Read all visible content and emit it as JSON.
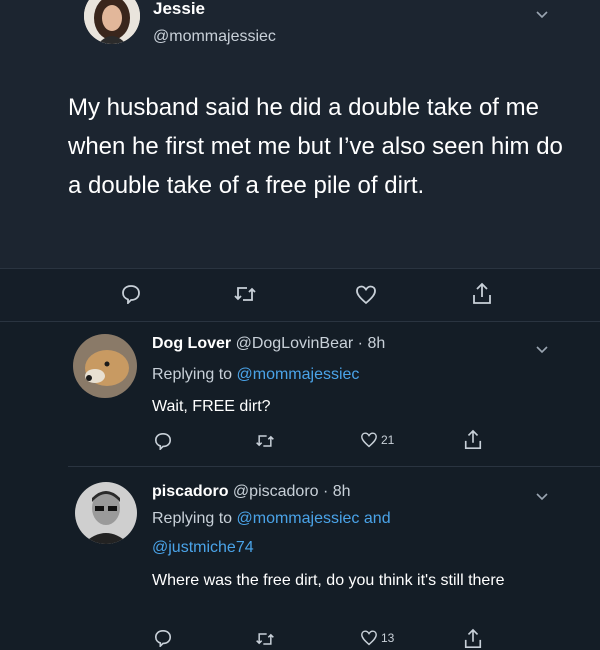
{
  "main_tweet": {
    "name": "Jessie",
    "handle": "@mommajessiec",
    "text": "My husband said he did a double take of me when he first met me but I’ve also seen him do a double take of a free pile of dirt."
  },
  "replies": [
    {
      "name": "Dog Lover",
      "handle": "@DogLovinBear",
      "time": "· 8h",
      "replying_prefix": "Replying to",
      "replying_to_1": "@mommajessiec",
      "text": "Wait, FREE dirt?",
      "likes": "21"
    },
    {
      "name": "piscadoro",
      "handle": "@piscadoro",
      "time": "· 8h",
      "replying_prefix": "Replying to",
      "replying_to_1": "@mommajessiec",
      "replying_and": "and",
      "replying_to_2": "@justmiche74",
      "text": "Where was the free dirt, do you think it's still there",
      "likes": "13"
    }
  ],
  "colors": {
    "background": "#141d26",
    "main_tweet_bg": "#1c2530",
    "link": "#4aa3e8",
    "muted": "#c8d0d8"
  }
}
